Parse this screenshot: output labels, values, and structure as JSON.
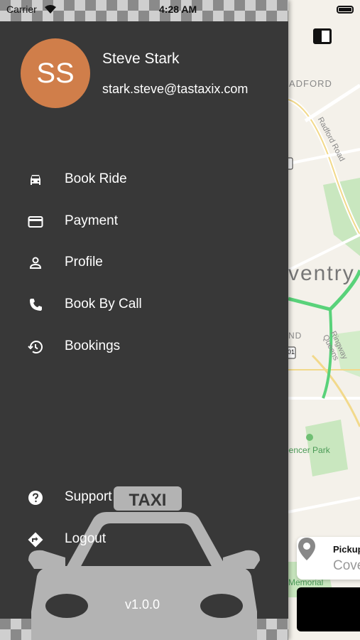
{
  "status_bar": {
    "carrier": "Carrier",
    "time": "4:28 AM"
  },
  "user": {
    "initials": "SS",
    "name": "Steve Stark",
    "email": "stark.steve@tastaxix.com",
    "avatar_color": "#d07e4a"
  },
  "menu": {
    "items": [
      {
        "label": "Book Ride",
        "icon": "car-icon"
      },
      {
        "label": "Payment",
        "icon": "credit-card-icon"
      },
      {
        "label": "Profile",
        "icon": "person-icon"
      },
      {
        "label": "Book By Call",
        "icon": "phone-icon"
      },
      {
        "label": "Bookings",
        "icon": "history-icon"
      }
    ],
    "bottom_items": [
      {
        "label": "Support",
        "icon": "help-icon"
      },
      {
        "label": "Logout",
        "icon": "directions-icon"
      }
    ]
  },
  "taxi_sign": "TAXI",
  "version": "v1.0.0",
  "map": {
    "labels": [
      "ADFORD",
      "Radford Road",
      "ventry",
      "Ringway Queens",
      "ND",
      "pencer Park",
      "Memorial"
    ],
    "road_shields": [
      "01"
    ],
    "pickup": {
      "title": "Pickup",
      "value": "Cove"
    }
  },
  "colors": {
    "drawer_bg": "#383838",
    "avatar": "#d07e4a",
    "map_bg": "#f4f1ea",
    "route_green": "#59d27a"
  }
}
